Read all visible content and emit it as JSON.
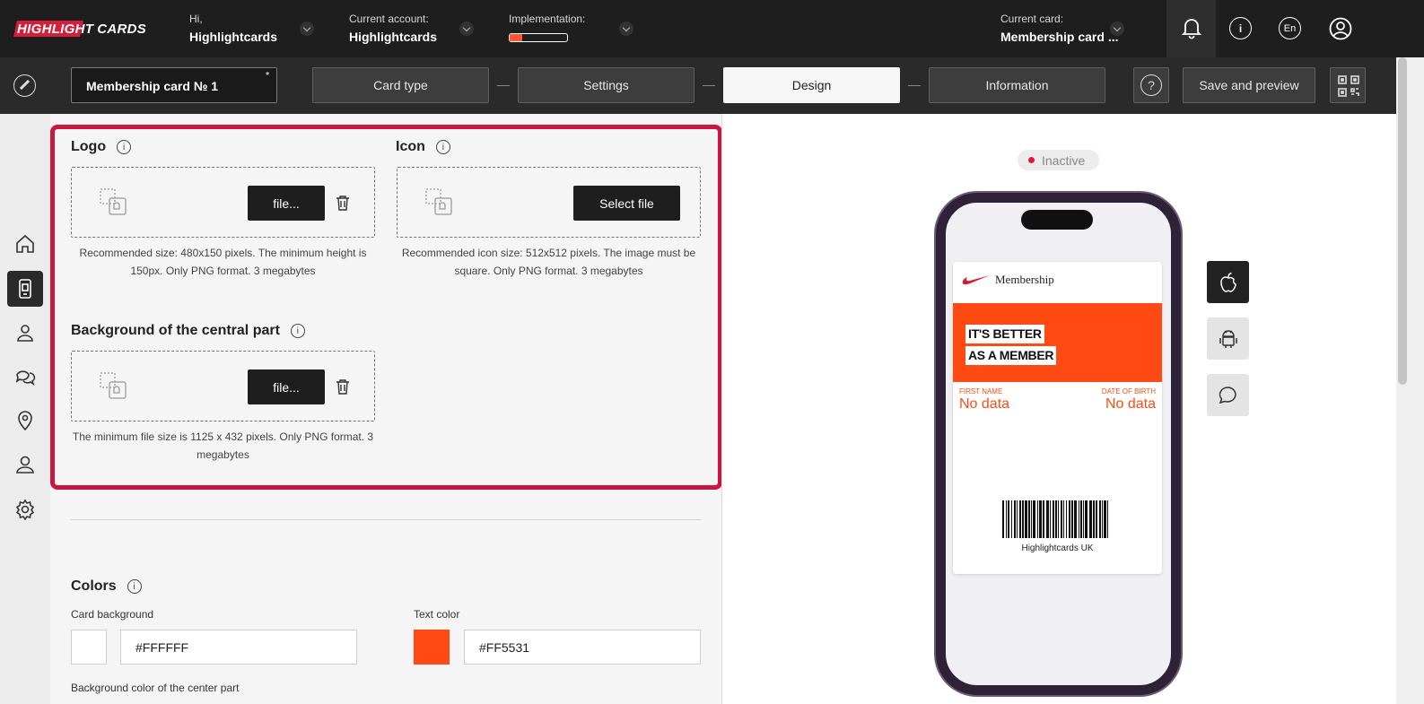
{
  "header": {
    "logo_part1": "HIGHLIGHT",
    "logo_part2": "CARDS",
    "greeting_label": "Hi,",
    "greeting_name": "Highlightcards",
    "account_label": "Current account:",
    "account_value": "Highlightcards",
    "implementation_label": "Implementation:",
    "implementation_progress": 0.22,
    "current_card_label": "Current card:",
    "current_card_value": "Membership card ...",
    "language": "En",
    "info_glyph": "i"
  },
  "toolbar": {
    "card_name": "Membership card № 1",
    "required_mark": "*",
    "steps": [
      {
        "label": "Card type"
      },
      {
        "label": "Settings"
      },
      {
        "label": "Design"
      },
      {
        "label": "Information"
      }
    ],
    "active_step": "Design",
    "help_glyph": "?",
    "save_label": "Save and preview"
  },
  "nav": {
    "items": [
      "home-icon",
      "card-icon",
      "users-icon",
      "chat-icon",
      "location-icon",
      "user-icon",
      "gear-icon"
    ],
    "active": "card-icon"
  },
  "design": {
    "info_glyph": "i",
    "logo": {
      "title": "Logo",
      "button": "file...",
      "hint": "Recommended size: 480x150 pixels. The minimum height is 150px. Only PNG format. 3 megabytes"
    },
    "icon": {
      "title": "Icon",
      "button": "Select file",
      "hint": "Recommended icon size: 512x512 pixels. The image must be square. Only PNG format. 3 megabytes"
    },
    "background": {
      "title": "Background of the central part",
      "button": "file...",
      "hint": "The minimum file size is 1125 x 432 pixels. Only PNG format. 3 megabytes"
    },
    "colors": {
      "title": "Colors",
      "card_background_label": "Card background",
      "card_background_value": "#FFFFFF",
      "text_color_label": "Text color",
      "text_color_value": "#FF5531",
      "center_bg_label": "Background color of the center part"
    }
  },
  "preview": {
    "status": "Inactive",
    "pass": {
      "brand": "Membership",
      "banner_line1": "IT'S BETTER",
      "banner_line2": "AS A MEMBER",
      "field1_label": "FIRST NAME",
      "field1_value": "No data",
      "field2_label": "DATE OF BIRTH",
      "field2_value": "No data",
      "barcode_text": "Highlightcards UK"
    },
    "platforms": [
      "apple-icon",
      "android-icon",
      "message-icon"
    ],
    "active_platform": "apple-icon"
  },
  "colors": {
    "accent": "#FF5531",
    "highlight_border": "#C8183F",
    "topbar": "#1E1E1E",
    "status_dot": "#E0193C"
  }
}
